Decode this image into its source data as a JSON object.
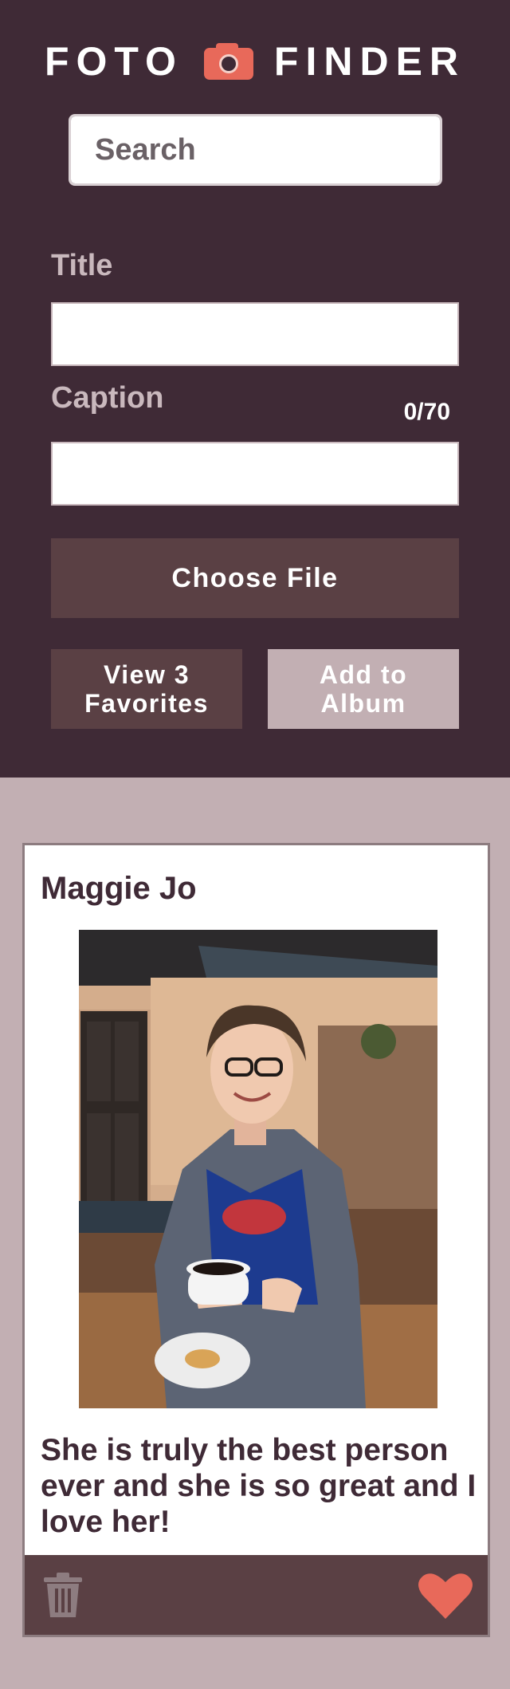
{
  "brand": {
    "left": "FOTO",
    "right": "FINDER",
    "accent_color": "#e8695a"
  },
  "search": {
    "placeholder": "Search",
    "icon": "search-icon"
  },
  "form": {
    "title_label": "Title",
    "title_value": "",
    "caption_label": "Caption",
    "caption_value": "",
    "caption_counter": "0/70",
    "choose_file_label": "Choose File",
    "view_favorites_label": "View 3 Favorites",
    "add_to_album_label": "Add to Album"
  },
  "cards": [
    {
      "title": "Maggie Jo",
      "caption": "She is truly the best person ever and she is so great and I love her!",
      "favorited": true,
      "icons": [
        "trash-icon",
        "heart-icon"
      ]
    }
  ],
  "colors": {
    "header_bg": "#3f2a36",
    "page_bg": "#c2afb3",
    "button_dark": "#5a4044",
    "heart": "#e8695a"
  }
}
